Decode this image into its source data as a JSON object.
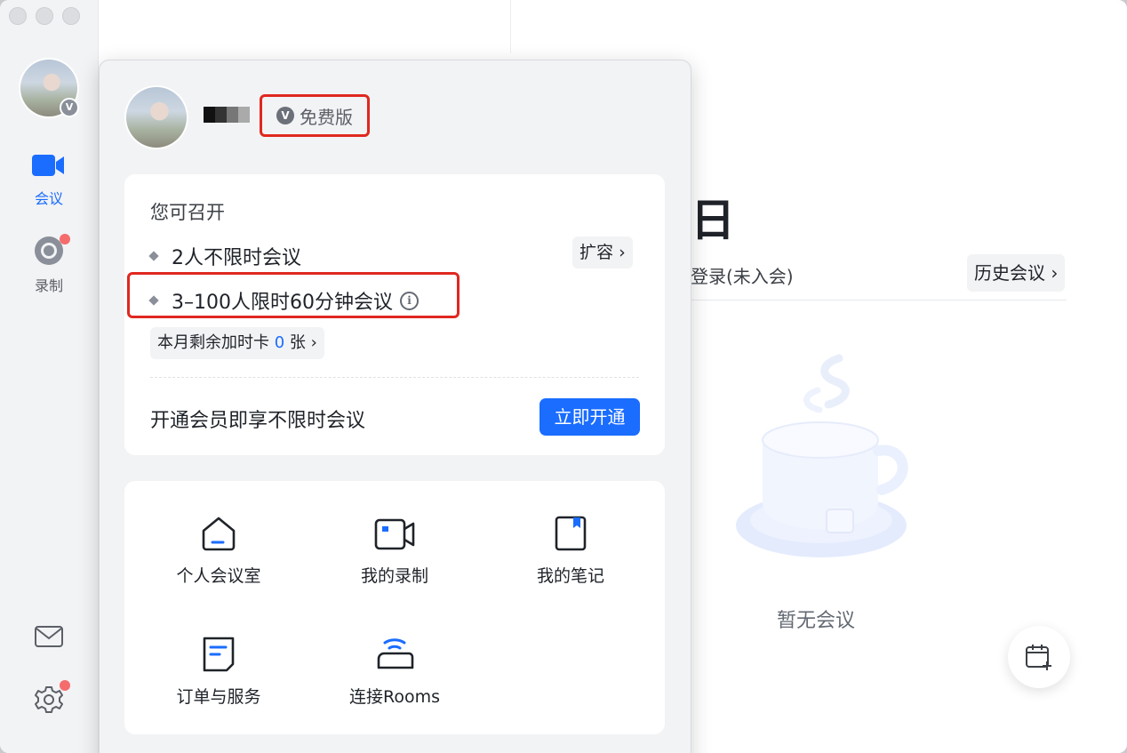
{
  "rail": {
    "nav": [
      {
        "label": "会议",
        "icon": "video-camera-icon",
        "active": true
      },
      {
        "label": "录制",
        "icon": "record-icon",
        "active": false
      }
    ],
    "avatar_badge": "V"
  },
  "main": {
    "date_glyph": "日",
    "login_status": "登录(未入会)",
    "history_label": "历史会议",
    "empty_text": "暂无会议"
  },
  "popover": {
    "plan_badge_icon": "V",
    "plan_badge_label": "免费版",
    "card1": {
      "heading": "您可召开",
      "items": [
        {
          "label": "2人不限时会议"
        },
        {
          "label": "3–100人限时60分钟会议"
        }
      ],
      "expand_label": "扩容",
      "extend_prefix": "本月剩余加时卡",
      "extend_count": "0",
      "extend_suffix": "张",
      "vip_text": "开通会员即享不限时会议",
      "open_button": "立即开通"
    },
    "tiles": [
      {
        "label": "个人会议室",
        "icon": "home-icon"
      },
      {
        "label": "我的录制",
        "icon": "recording-camera-icon"
      },
      {
        "label": "我的笔记",
        "icon": "note-icon"
      },
      {
        "label": "订单与服务",
        "icon": "order-icon"
      },
      {
        "label": "连接Rooms",
        "icon": "rooms-connect-icon"
      }
    ]
  },
  "colors": {
    "accent": "#1a6dff",
    "highlight_red": "#e0281f",
    "badge_red": "#f56c6c"
  }
}
